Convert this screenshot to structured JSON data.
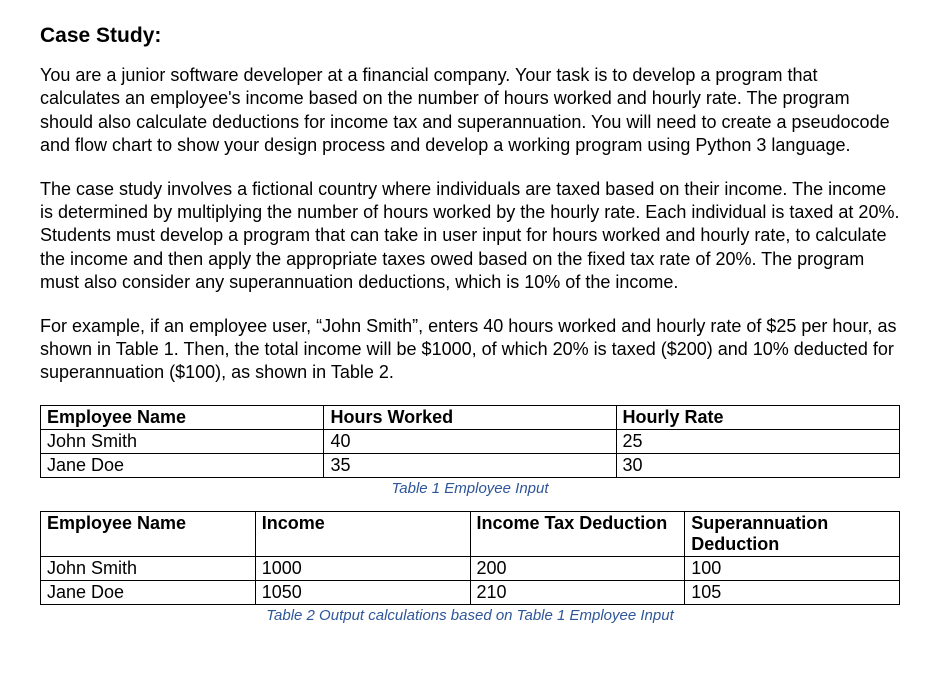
{
  "heading": "Case Study:",
  "paragraphs": [
    "You are a junior software developer at a financial company. Your task is to develop a program that calculates an employee's income based on the number of hours worked and hourly rate. The program should also calculate deductions for income tax and superannuation. You will need to create a pseudocode and flow chart to show your design process and develop a working program using Python 3 language.",
    "The case study involves a fictional country where individuals are taxed based on their income. The income is determined by multiplying the number of hours worked by the hourly rate. Each individual is taxed at 20%. Students must develop a program that can take in user input for hours worked and hourly rate, to calculate the income and then apply the appropriate taxes owed based on the fixed tax rate of 20%. The program must also consider any superannuation deductions, which is 10% of the income.",
    "For example, if an employee user, “John Smith”, enters 40 hours worked and hourly rate of $25 per hour, as shown in Table 1. Then, the total income will be $1000, of which 20% is taxed ($200) and 10% deducted for superannuation ($100), as shown in Table 2."
  ],
  "table1": {
    "headers": [
      "Employee Name",
      "Hours Worked",
      "Hourly Rate"
    ],
    "rows": [
      {
        "name": "John Smith",
        "hours": "40",
        "rate": "25"
      },
      {
        "name": "Jane Doe",
        "hours": "35",
        "rate": "30"
      }
    ],
    "caption": "Table 1 Employee Input"
  },
  "table2": {
    "headers": [
      "Employee Name",
      "Income",
      "Income Tax Deduction",
      "Superannuation Deduction"
    ],
    "rows": [
      {
        "name": "John Smith",
        "income": "1000",
        "tax": "200",
        "super": "100"
      },
      {
        "name": "Jane Doe",
        "income": "1050",
        "tax": "210",
        "super": "105"
      }
    ],
    "caption": "Table 2 Output calculations based on Table 1 Employee Input"
  }
}
